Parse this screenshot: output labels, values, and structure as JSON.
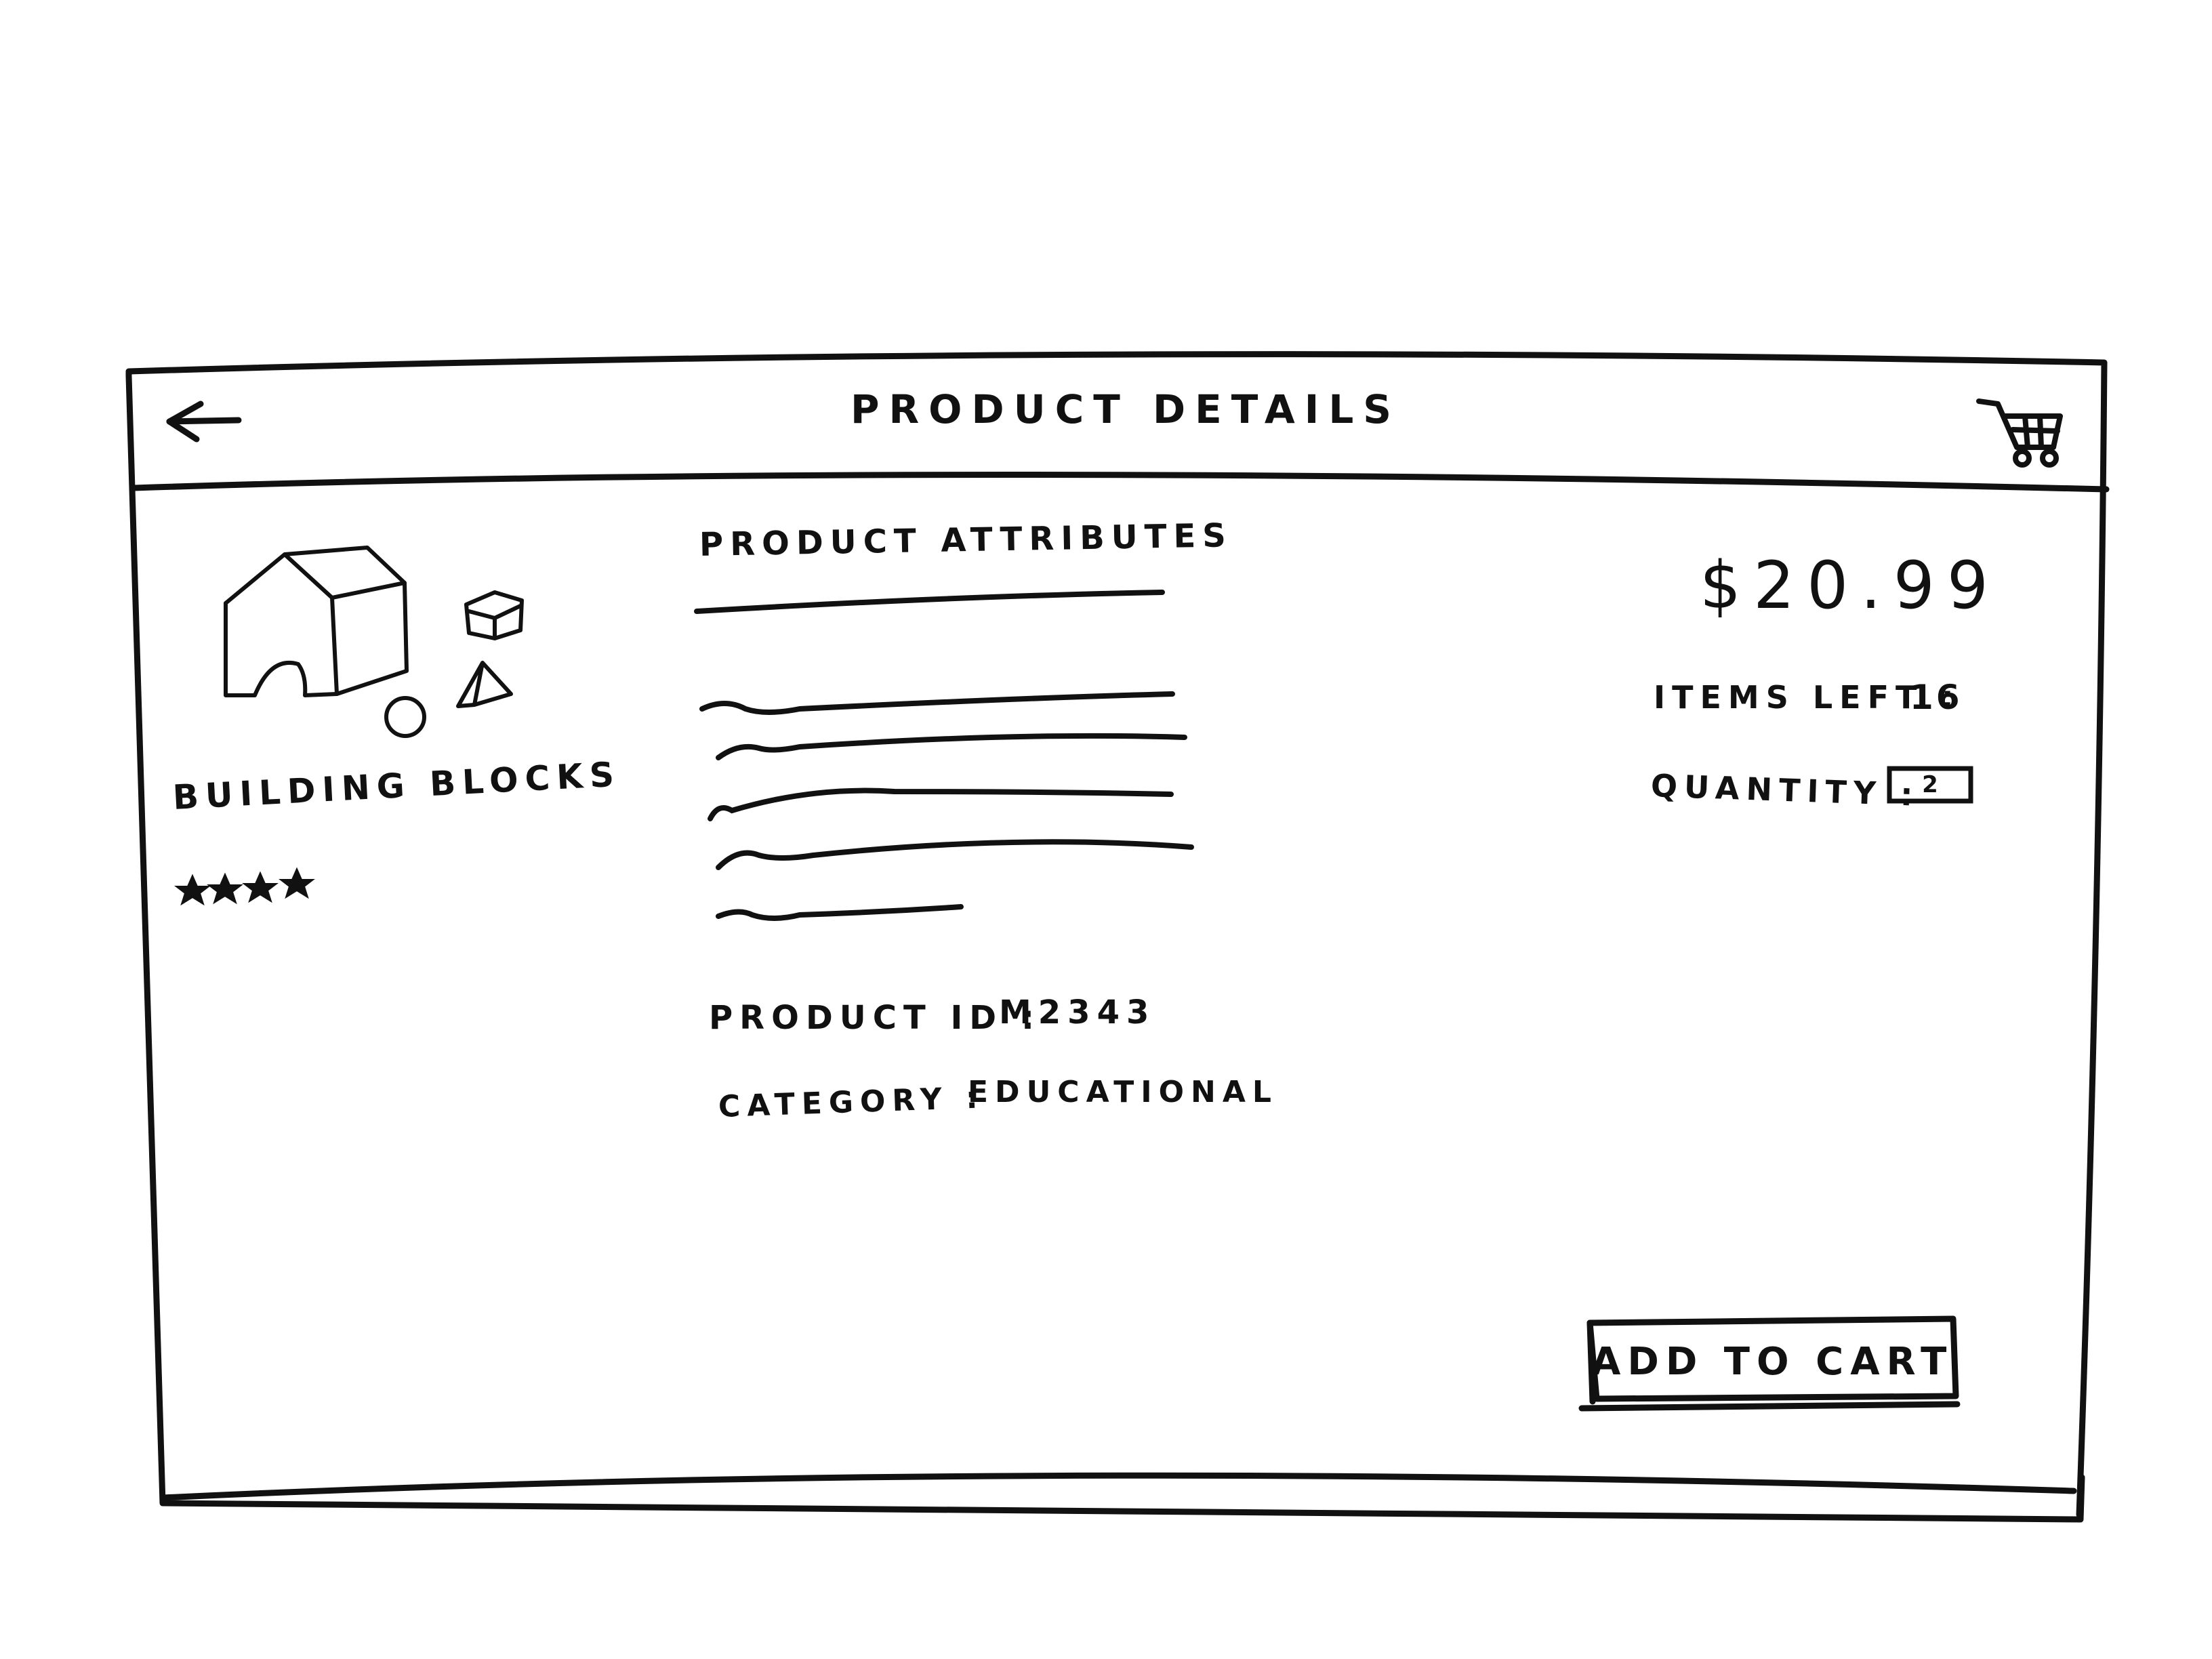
{
  "header": {
    "title": "PRODUCT DETAILS",
    "back_icon": "arrow-left-icon",
    "cart_icon": "shopping-cart-icon"
  },
  "product": {
    "name": "BUILDING BLOCKS",
    "image_icon": "building-blocks-image",
    "rating_stars": 4,
    "rating_max": 4
  },
  "attributes": {
    "heading": "PRODUCT ATTRIBUTES",
    "product_id_label": "PRODUCT ID :",
    "product_id_value": "M2343",
    "category_label": "CATEGORY :",
    "category_value": "EDUCATIONAL"
  },
  "purchase": {
    "price": "$20.99",
    "items_left_label": "ITEMS LEFT :",
    "items_left_value": "16",
    "quantity_label": "QUANTITY :",
    "quantity_value": "2",
    "add_to_cart_label": "ADD TO CART"
  }
}
